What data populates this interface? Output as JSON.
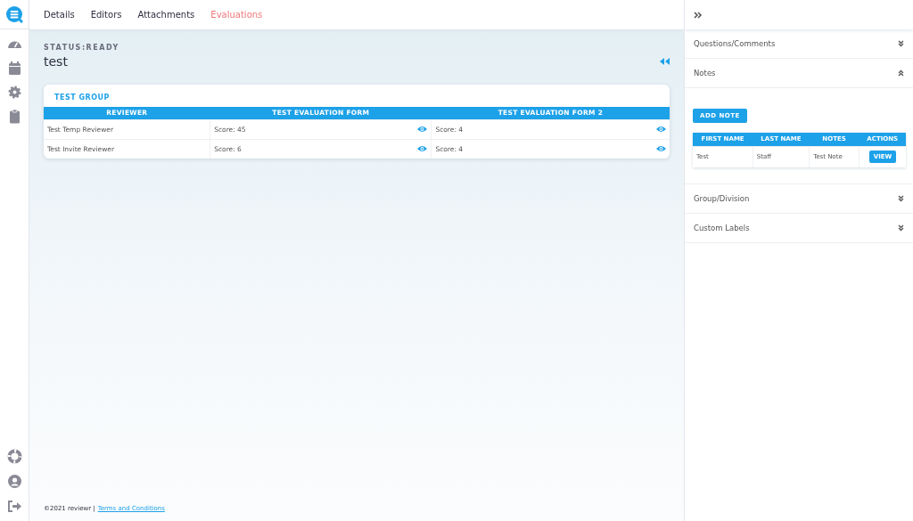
{
  "tabs": [
    {
      "label": "Details",
      "selected": false
    },
    {
      "label": "Editors",
      "selected": false
    },
    {
      "label": "Attachments",
      "selected": false
    },
    {
      "label": "Evaluations",
      "selected": true
    }
  ],
  "status": "STATUS:READY",
  "title": "test",
  "group": {
    "title": "TEST GROUP",
    "columns": [
      "REVIEWER",
      "TEST EVALUATION FORM",
      "TEST EVALUATION FORM 2"
    ],
    "rows": [
      {
        "reviewer": "Test Temp Reviewer",
        "scores": [
          "Score: 45",
          "Score: 4"
        ]
      },
      {
        "reviewer": "Test Invite Reviewer",
        "scores": [
          "Score: 6",
          "Score: 4"
        ]
      }
    ]
  },
  "footer": {
    "text": "©2021 reviewr |",
    "link": "Terms and Conditions"
  },
  "panel": {
    "sections": [
      {
        "title": "Questions/Comments",
        "expanded": false
      },
      {
        "title": "Notes",
        "expanded": true,
        "button": "ADD NOTE",
        "columns": [
          "FIRST NAME",
          "LAST NAME",
          "NOTES",
          "ACTIONS"
        ],
        "rows": [
          {
            "cells": [
              "Test",
              "Staff",
              "Test Note"
            ],
            "action": "VIEW"
          }
        ]
      },
      {
        "title": "Group/Division",
        "expanded": false
      },
      {
        "title": "Custom Labels",
        "expanded": false
      }
    ]
  }
}
